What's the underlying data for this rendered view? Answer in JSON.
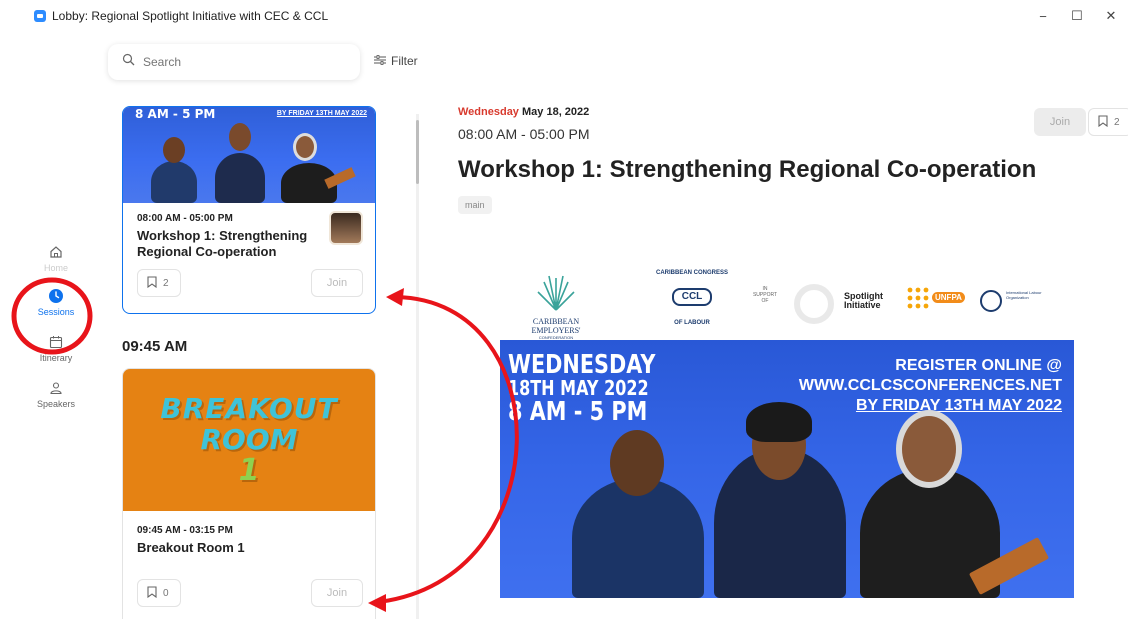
{
  "window": {
    "title": "Lobby: Regional Spotlight Initiative with CEC & CCL",
    "controls": [
      "−",
      "☐",
      "✕"
    ]
  },
  "search": {
    "placeholder": "Search"
  },
  "filter": {
    "label": "Filter"
  },
  "nav": [
    {
      "label": "Home",
      "icon": "home-icon"
    },
    {
      "label": "Sessions",
      "icon": "clock-icon",
      "active": true
    },
    {
      "label": "Itinerary",
      "icon": "calendar-icon"
    },
    {
      "label": "Speakers",
      "icon": "person-icon"
    }
  ],
  "list": {
    "card1": {
      "banner_time": "8 AM - 5 PM",
      "banner_by": "BY FRIDAY 13TH MAY 2022",
      "time": "08:00 AM - 05:00 PM",
      "title": "Workshop 1: Strengthening Regional Co-operation",
      "bookmarks": "2",
      "join": "Join"
    },
    "group_time": "09:45 AM",
    "card2": {
      "banner_line1": "BREAKOUT",
      "banner_line2": "ROOM",
      "banner_line3": "1",
      "time": "09:45 AM - 03:15 PM",
      "title": "Breakout Room 1",
      "bookmarks": "0",
      "join": "Join"
    }
  },
  "detail": {
    "weekday": "Wednesday",
    "date": "May 18, 2022",
    "time": "08:00 AM - 05:00 PM",
    "title": "Workshop 1: Strengthening Regional Co-operation",
    "tag": "main",
    "join": "Join",
    "bookmarks": "2",
    "logos": {
      "cec": "CARIBBEAN EMPLOYERS'",
      "cec_sub": "CONFEDERATION",
      "ccl_top": "CARIBBEAN CONGRESS",
      "ccl_mid": "CCL",
      "ccl_bottom": "OF LABOUR",
      "in_support": "IN SUPPORT OF",
      "spotlight": "Spotlight Initiative",
      "unfpa": "UNFPA",
      "ilo": "International Labour Organization"
    },
    "hero": {
      "left1": "WEDNESDAY",
      "left2": "18TH MAY 2022",
      "left3": "8 AM - 5 PM",
      "right1": "REGISTER ONLINE @",
      "right2": "WWW.CCLCSCONFERENCES.NET",
      "right3": "BY FRIDAY 13TH MAY 2022"
    }
  },
  "colors": {
    "accent": "#0e72ed",
    "annotation": "#e8141a",
    "weekday": "#d83a2e",
    "breakout": "#e58213"
  }
}
